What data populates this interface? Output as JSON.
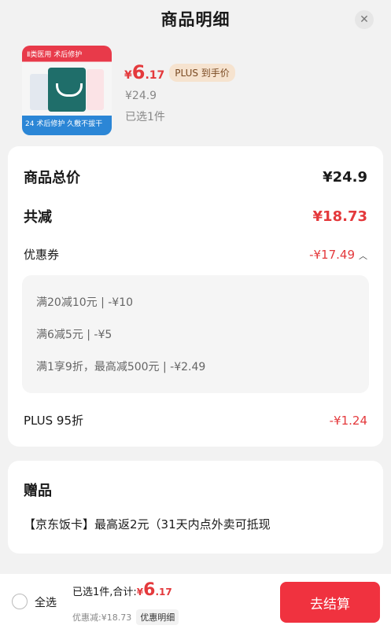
{
  "header": {
    "title": "商品明细",
    "close_icon": "close-icon"
  },
  "product": {
    "thumb_top_text": "Ⅱ类医用  术后修护",
    "thumb_bottom_text": "24 术后修护 久敷不拔干",
    "price_yen": "¥",
    "price_int": "6",
    "price_dec": ".17",
    "plus_tag": "PLUS 到手价",
    "original_price": "¥24.9",
    "selected": "已选1件"
  },
  "summary": {
    "total_label": "商品总价",
    "total_value": "¥24.9",
    "reduce_label": "共减",
    "reduce_value": "¥18.73",
    "coupon_label": "优惠券",
    "coupon_value": "-¥17.49",
    "coupon_items": [
      "满20减10元 | -¥10",
      "满6减5元 | -¥5",
      "满1享9折，最高减500元 | -¥2.49"
    ],
    "plus_label": "PLUS 95折",
    "plus_value": "-¥1.24"
  },
  "gift": {
    "title": "赠品",
    "text": "【京东饭卡】最高返2元（31天内点外卖可抵现"
  },
  "bottom": {
    "select_all": "全选",
    "total_label": "已选1件,合计:",
    "price_yen": "¥",
    "price_int": "6",
    "price_dec": ".17",
    "discount_text": "优惠减:¥18.73",
    "detail_button": "优惠明细",
    "checkout_button": "去结算"
  },
  "colors": {
    "accent_red": "#e4393c",
    "checkout_red": "#f0323f",
    "plus_tag_bg": "#f6e3cf"
  }
}
